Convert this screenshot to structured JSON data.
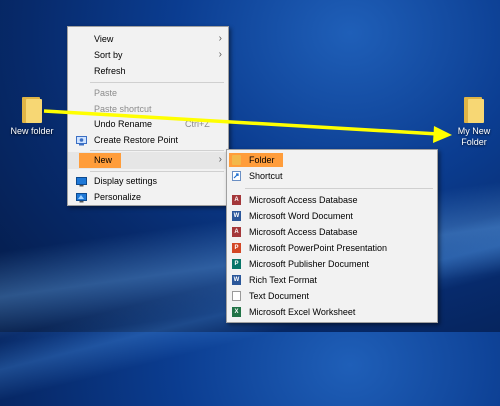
{
  "desktop": {
    "icons": [
      {
        "label": "New folder"
      },
      {
        "label": "My New Folder"
      }
    ]
  },
  "context_menu": {
    "view": "View",
    "sort_by": "Sort by",
    "refresh": "Refresh",
    "paste": "Paste",
    "paste_shortcut": "Paste shortcut",
    "undo_rename": "Undo Rename",
    "undo_shortcut": "Ctrl+Z",
    "create_restore_point": "Create Restore Point",
    "new": "New",
    "display_settings": "Display settings",
    "personalize": "Personalize"
  },
  "new_submenu": {
    "folder": "Folder",
    "shortcut": "Shortcut",
    "items": [
      {
        "label": "Microsoft Access Database",
        "icon": "access-icon",
        "color": "#a4373a"
      },
      {
        "label": "Microsoft Word Document",
        "icon": "word-icon",
        "color": "#2b579a"
      },
      {
        "label": "Microsoft Access Database",
        "icon": "access-icon",
        "color": "#a4373a"
      },
      {
        "label": "Microsoft PowerPoint Presentation",
        "icon": "powerpoint-icon",
        "color": "#d24726"
      },
      {
        "label": "Microsoft Publisher Document",
        "icon": "publisher-icon",
        "color": "#077568"
      },
      {
        "label": "Rich Text Format",
        "icon": "rtf-icon",
        "color": "#2b579a"
      },
      {
        "label": "Text Document",
        "icon": "text-document-icon",
        "color": "#9a9a9a"
      },
      {
        "label": "Microsoft Excel Worksheet",
        "icon": "excel-icon",
        "color": "#217346"
      }
    ]
  },
  "colors": {
    "highlight": "#ff9d3b",
    "arrow": "#ffff00"
  }
}
